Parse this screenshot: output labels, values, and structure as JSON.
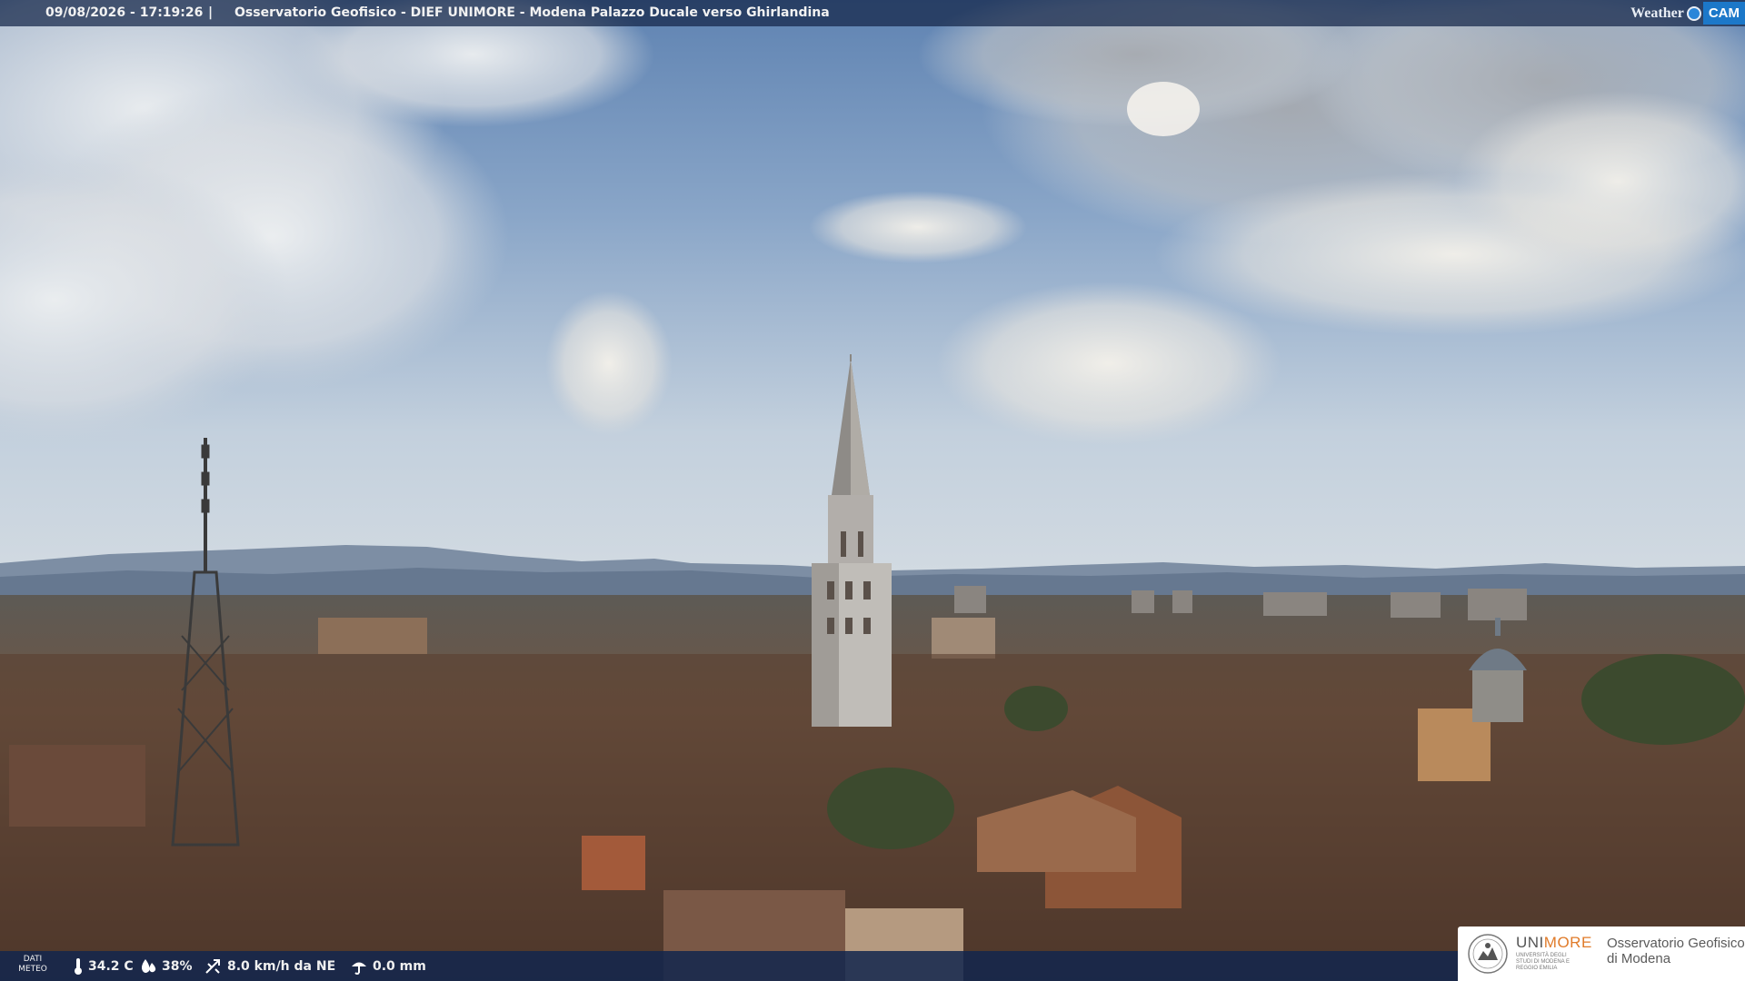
{
  "overlay_top": {
    "timestamp": "09/08/2026 - 17:19:26",
    "separator": "|",
    "title": "Osservatorio Geofisico - DIEF UNIMORE - Modena Palazzo Ducale verso Ghirlandina",
    "brand_word": "Weather",
    "brand_tag": "CAM"
  },
  "overlay_bottom": {
    "label_line1": "DATI",
    "label_line2": "METEO",
    "temperature": "34.2 C",
    "humidity": "38%",
    "wind": "8.0 km/h da NE",
    "rain": "0.0 mm",
    "icons": [
      "thermometer-icon",
      "humidity-drop-icon",
      "wind-icon",
      "rain-gauge-icon"
    ]
  },
  "logo": {
    "uni_part1": "UNI",
    "uni_part2": "MORE",
    "uni_sub": "UNIVERSITÀ DEGLI STUDI DI MODENA E REGGIO EMILIA",
    "observatory_line1": "Osservatorio Geofisico",
    "observatory_line2": "di Modena"
  },
  "colors": {
    "sky_top": "#6a8cb6",
    "sky_haze": "#c7d3df",
    "mountains": "#6d7f96",
    "roofs": "#6b4a36",
    "overlay_blue": "#1c3d72",
    "brand_orange": "#e07b2a"
  }
}
